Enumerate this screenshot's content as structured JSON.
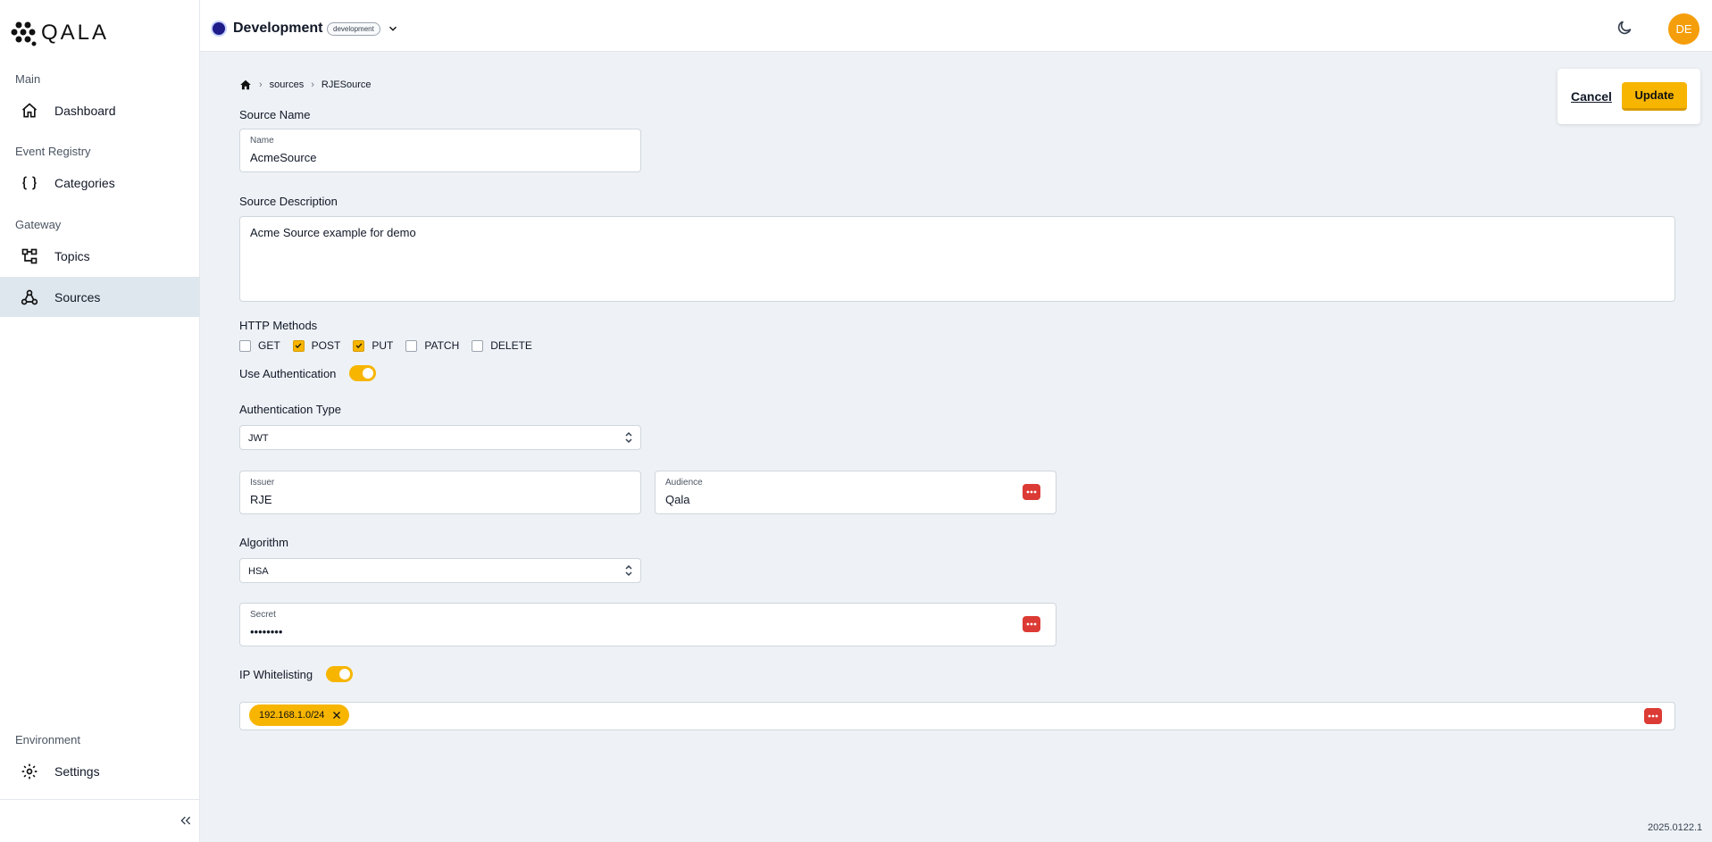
{
  "brand": {
    "logo_text": "QALA"
  },
  "sidebar": {
    "sections": [
      {
        "label": "Main"
      },
      {
        "label": "Event Registry"
      },
      {
        "label": "Gateway"
      },
      {
        "label": "Environment"
      }
    ],
    "items": [
      {
        "label": "Dashboard",
        "icon": "home-icon"
      },
      {
        "label": "Categories",
        "icon": "braces-icon"
      },
      {
        "label": "Topics",
        "icon": "hierarchy-icon"
      },
      {
        "label": "Sources",
        "icon": "webhook-icon",
        "active": true
      },
      {
        "label": "Settings",
        "icon": "gear-icon"
      }
    ]
  },
  "topbar": {
    "env_name": "Development",
    "env_badge": "development",
    "avatar_initials": "DE"
  },
  "breadcrumb": {
    "items": [
      "sources",
      "RJESource"
    ]
  },
  "actions": {
    "cancel": "Cancel",
    "update": "Update"
  },
  "form": {
    "source_name_label": "Source Name",
    "name_field_label": "Name",
    "name_value": "AcmeSource",
    "description_label": "Source Description",
    "description_value": "Acme Source example for demo",
    "http_methods_label": "HTTP Methods",
    "methods": [
      {
        "label": "GET",
        "checked": false
      },
      {
        "label": "POST",
        "checked": true
      },
      {
        "label": "PUT",
        "checked": true
      },
      {
        "label": "PATCH",
        "checked": false
      },
      {
        "label": "DELETE",
        "checked": false
      }
    ],
    "use_auth_label": "Use Authentication",
    "use_auth_on": true,
    "auth_type_label": "Authentication Type",
    "auth_type_value": "JWT",
    "issuer_label": "Issuer",
    "issuer_value": "RJE",
    "audience_label": "Audience",
    "audience_value": "Qala",
    "algorithm_label": "Algorithm",
    "algorithm_value": "HSA",
    "secret_label": "Secret",
    "secret_value": "••••••••",
    "ip_whitelisting_label": "IP Whitelisting",
    "ip_whitelisting_on": true,
    "ip_chips": [
      "192.168.1.0/24"
    ]
  },
  "colors": {
    "accent": "#f7b500",
    "danger": "#dc3b35",
    "active_nav": "#dfe7ee"
  },
  "version": "2025.0122.1"
}
